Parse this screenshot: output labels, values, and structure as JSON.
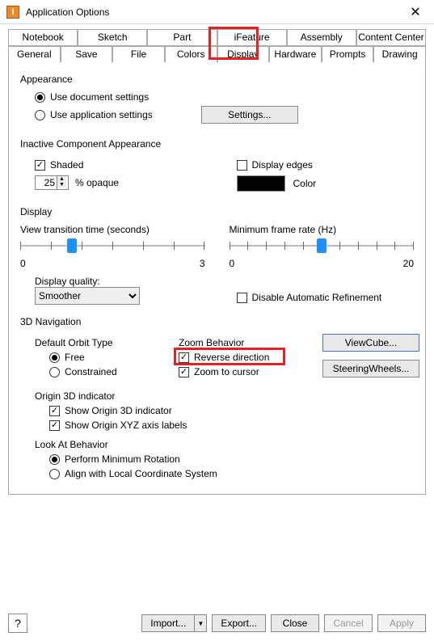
{
  "window": {
    "title": "Application Options"
  },
  "tabs_back": [
    "Notebook",
    "Sketch",
    "Part",
    "iFeature",
    "Assembly",
    "Content Center"
  ],
  "tabs_front": [
    "General",
    "Save",
    "File",
    "Colors",
    "Display",
    "Hardware",
    "Prompts",
    "Drawing"
  ],
  "appearance": {
    "title": "Appearance",
    "use_doc": "Use document settings",
    "use_app": "Use application settings",
    "settings_btn": "Settings..."
  },
  "inactive": {
    "title": "Inactive Component Appearance",
    "shaded": "Shaded",
    "opaque_value": "25",
    "opaque_label": "% opaque",
    "display_edges": "Display edges",
    "color_label": "Color"
  },
  "display": {
    "title": "Display",
    "trans_label": "View transition time (seconds)",
    "trans_min": "0",
    "trans_max": "3",
    "frame_label": "Minimum frame rate (Hz)",
    "frame_min": "0",
    "frame_max": "20",
    "quality_label": "Display quality:",
    "quality_value": "Smoother",
    "disable_refine": "Disable Automatic Refinement"
  },
  "nav": {
    "title": "3D Navigation",
    "orbit_label": "Default Orbit Type",
    "orbit_free": "Free",
    "orbit_constrained": "Constrained",
    "zoom_label": "Zoom Behavior",
    "reverse": "Reverse direction",
    "zoom_cursor": "Zoom to cursor",
    "viewcube": "ViewCube...",
    "steering": "SteeringWheels...",
    "origin_label": "Origin 3D indicator",
    "show_origin": "Show Origin 3D indicator",
    "show_xyz": "Show Origin XYZ axis labels",
    "lookat_label": "Look At Behavior",
    "min_rotation": "Perform Minimum Rotation",
    "align_local": "Align with Local Coordinate System"
  },
  "footer": {
    "help": "?",
    "import": "Import...",
    "export": "Export...",
    "close": "Close",
    "cancel": "Cancel",
    "apply": "Apply"
  }
}
